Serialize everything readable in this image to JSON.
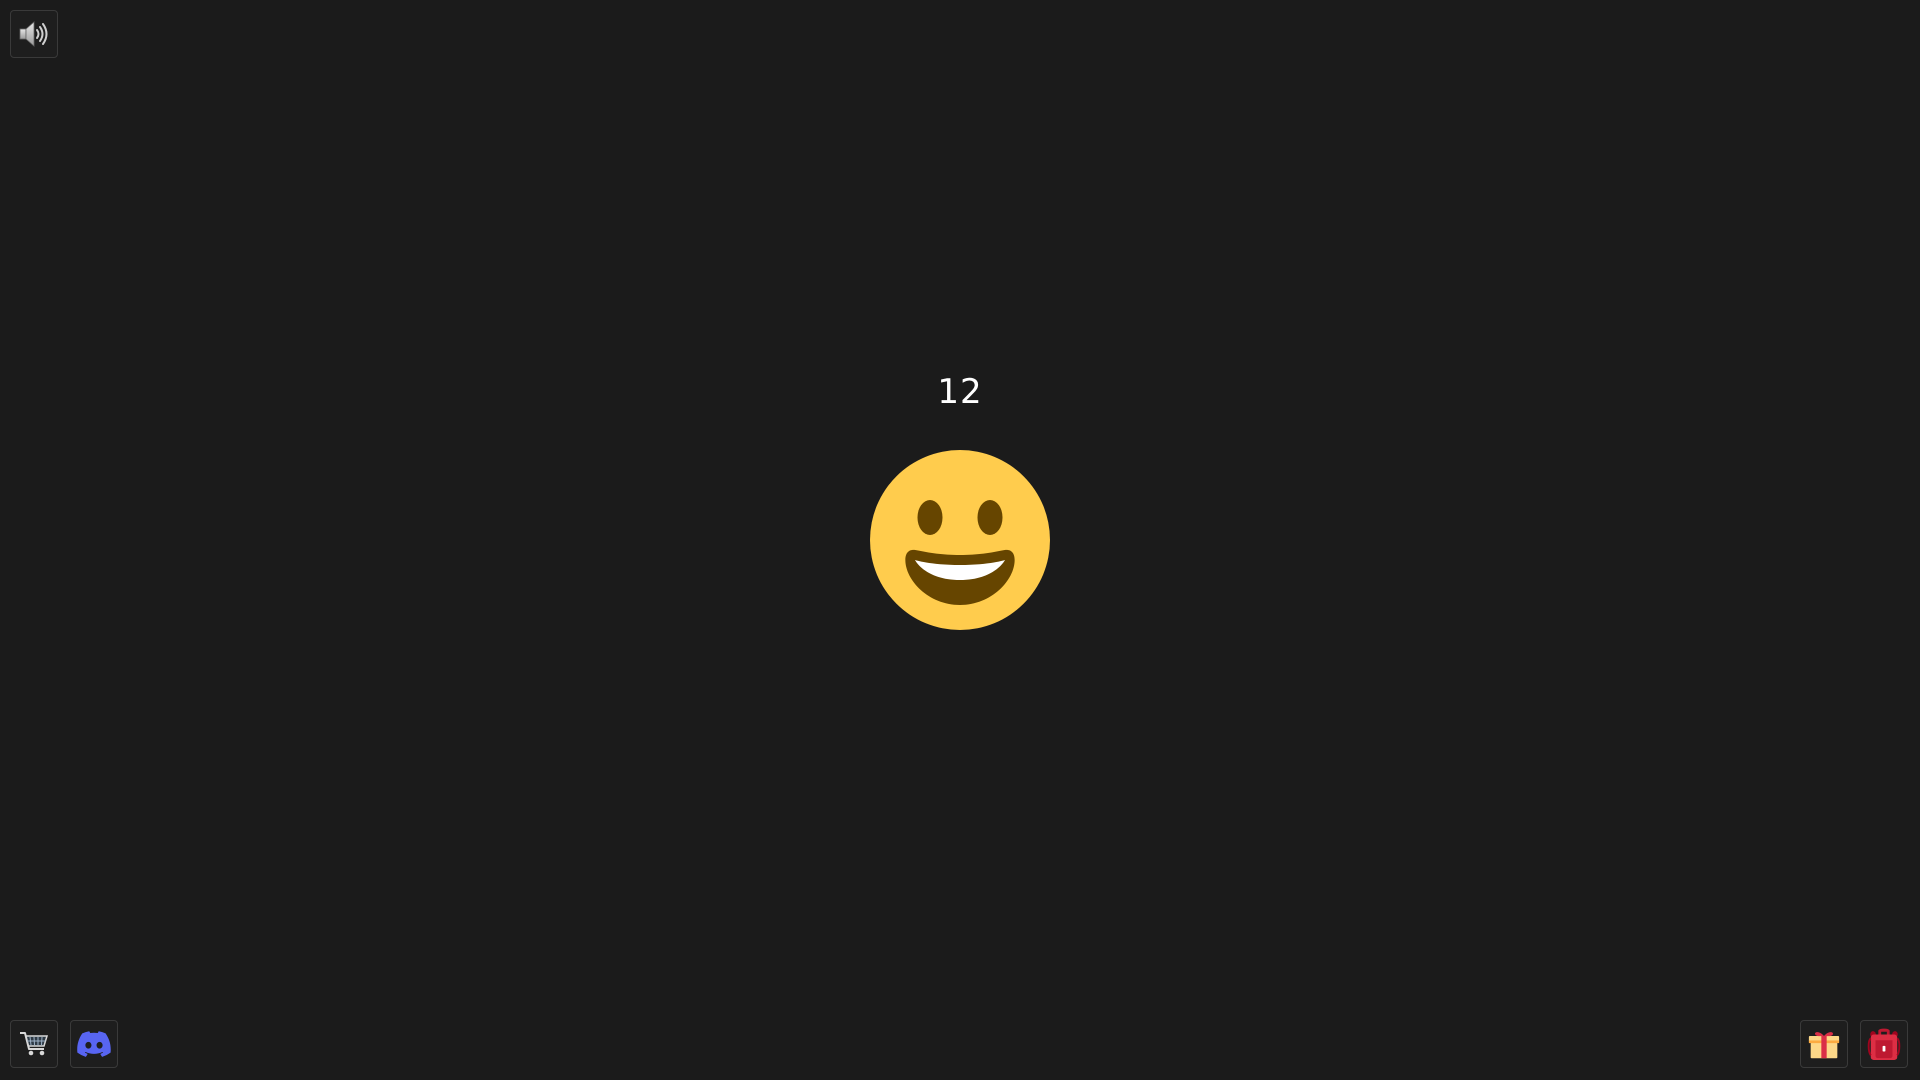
{
  "game": {
    "counter": "12",
    "emoji": "grinning-face"
  },
  "controls": {
    "sound": {
      "icon": "speaker-volume-icon",
      "state": "on"
    },
    "shop": {
      "icon": "shopping-cart-icon"
    },
    "discord": {
      "icon": "discord-icon",
      "color": "#5865F2"
    },
    "gift": {
      "icon": "gift-icon"
    },
    "backpack": {
      "icon": "backpack-icon"
    }
  },
  "colors": {
    "background": "#1b1b1b",
    "emoji_face": "#FFCC4D",
    "emoji_features": "#664500"
  }
}
